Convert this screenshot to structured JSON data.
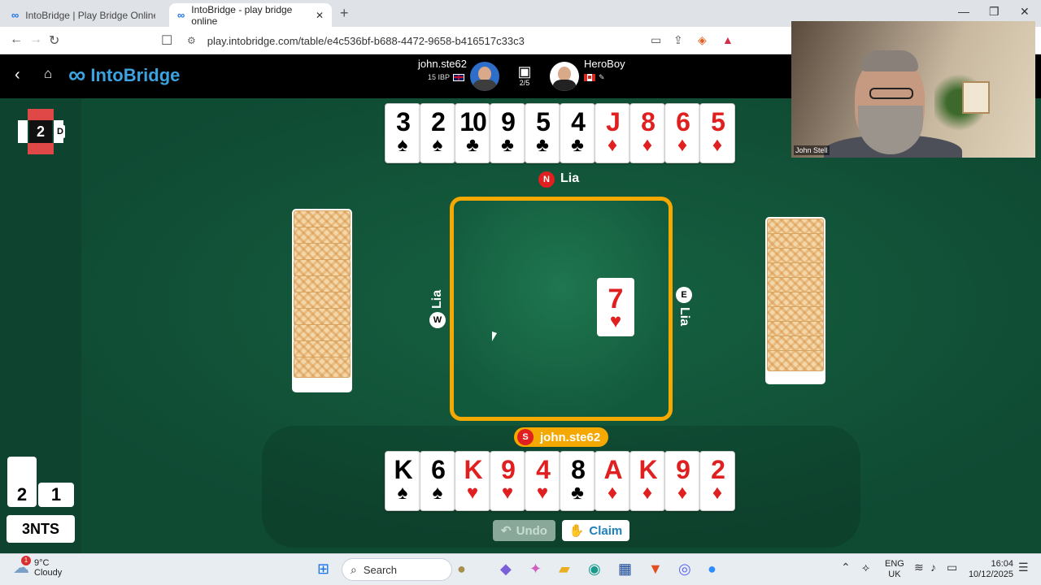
{
  "browser": {
    "tabs": [
      {
        "title": "IntoBridge | Play Bridge Online - For",
        "active": false
      },
      {
        "title": "IntoBridge - play bridge online",
        "active": true
      }
    ],
    "url": "play.intobridge.com/table/e4c536bf-b688-4472-9658-b416517c33c3"
  },
  "header": {
    "logo": "IntoBridge",
    "player1": {
      "name": "john.ste62",
      "rating": "15 IBP"
    },
    "round": "2/5",
    "player2": {
      "name": "HeroBoy"
    }
  },
  "board": {
    "number": "2",
    "dealer": "D",
    "tricks_ns": "2",
    "tricks_ew": "1",
    "contract": "3NTS"
  },
  "north": {
    "seat": "N",
    "name": "Lia",
    "cards": [
      {
        "rank": "3",
        "suit": "♠",
        "color": "black"
      },
      {
        "rank": "2",
        "suit": "♠",
        "color": "black"
      },
      {
        "rank": "10",
        "suit": "♣",
        "color": "black"
      },
      {
        "rank": "9",
        "suit": "♣",
        "color": "black"
      },
      {
        "rank": "5",
        "suit": "♣",
        "color": "black"
      },
      {
        "rank": "4",
        "suit": "♣",
        "color": "black"
      },
      {
        "rank": "J",
        "suit": "♦",
        "color": "red"
      },
      {
        "rank": "8",
        "suit": "♦",
        "color": "red"
      },
      {
        "rank": "6",
        "suit": "♦",
        "color": "red"
      },
      {
        "rank": "5",
        "suit": "♦",
        "color": "red"
      }
    ]
  },
  "west": {
    "seat": "W",
    "name": "Lia",
    "card_count": 10
  },
  "east": {
    "seat": "E",
    "name": "Lia",
    "card_count": 10
  },
  "south": {
    "seat": "S",
    "name": "john.ste62",
    "cards": [
      {
        "rank": "K",
        "suit": "♠",
        "color": "black"
      },
      {
        "rank": "6",
        "suit": "♠",
        "color": "black"
      },
      {
        "rank": "K",
        "suit": "♥",
        "color": "red"
      },
      {
        "rank": "9",
        "suit": "♥",
        "color": "red"
      },
      {
        "rank": "4",
        "suit": "♥",
        "color": "red"
      },
      {
        "rank": "8",
        "suit": "♣",
        "color": "black"
      },
      {
        "rank": "A",
        "suit": "♦",
        "color": "red"
      },
      {
        "rank": "K",
        "suit": "♦",
        "color": "red"
      },
      {
        "rank": "9",
        "suit": "♦",
        "color": "red"
      },
      {
        "rank": "2",
        "suit": "♦",
        "color": "red"
      }
    ]
  },
  "trick": {
    "played": {
      "rank": "7",
      "suit": "♥",
      "color": "red",
      "by": "E"
    }
  },
  "actions": {
    "undo": "Undo",
    "claim": "Claim"
  },
  "video": {
    "name": "John Stell"
  },
  "taskbar": {
    "weather_temp": "9°C",
    "weather_desc": "Cloudy",
    "weather_badge": "1",
    "search": "Search",
    "lang1": "ENG",
    "lang2": "UK",
    "time": "16:04",
    "date": "10/12/2025"
  },
  "colors": {
    "accent": "#f5a800",
    "felt": "#0f4a33",
    "red_suit": "#e02020",
    "brand": "#3aa3e0"
  }
}
